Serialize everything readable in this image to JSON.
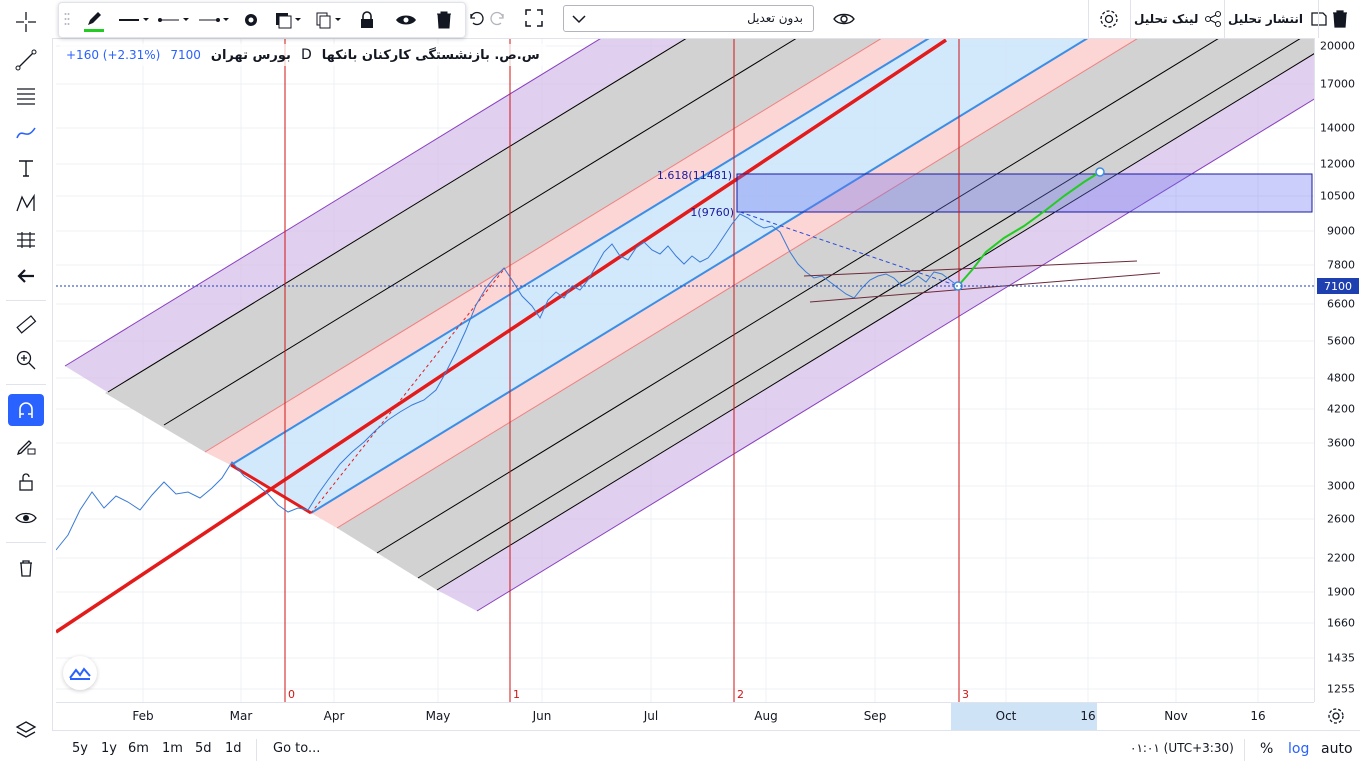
{
  "symbol": {
    "name": "س.ص. بازنشستگی کارکنان بانکها",
    "interval": "D",
    "exchange": "بورس تهران",
    "price": "7100",
    "change": "+160 (+2.31%)"
  },
  "top_toolbar": {
    "adjust_select": "بدون تعدیل",
    "link_analysis": "لینک تحلیل",
    "publish_analysis": "انتشار تحلیل"
  },
  "price_axis": {
    "labels": [
      "20000",
      "17000",
      "14000",
      "12000",
      "10500",
      "9000",
      "7800",
      "6600",
      "5600",
      "4800",
      "4200",
      "3600",
      "3000",
      "2600",
      "2200",
      "1900",
      "1660",
      "1435",
      "1255"
    ],
    "current_price": "7100"
  },
  "time_axis": {
    "labels": [
      "Feb",
      "Mar",
      "Apr",
      "May",
      "Jun",
      "Jul",
      "Aug",
      "Sep",
      "Oct",
      "16",
      "Nov",
      "16"
    ]
  },
  "drawings": {
    "cycle_labels": [
      "0",
      "1",
      "2",
      "3"
    ],
    "fib_levels": [
      "1.618(11481)",
      "1(9760)"
    ]
  },
  "bottom_bar": {
    "ranges": [
      "5y",
      "1y",
      "6m",
      "1m",
      "5d",
      "1d"
    ],
    "goto": "Go to...",
    "time": "۰۱:۰۱ (UTC+3:30)",
    "percent": "%",
    "log": "log",
    "auto": "auto"
  },
  "colors": {
    "accent": "#2962ff",
    "trend_red": "#e31b1b",
    "channel_purple": "#d6bfe8",
    "channel_blue": "#cde6fb",
    "channel_pink": "#fcd5d5",
    "channel_gray": "#d2d2d2",
    "projection_green": "#22cc22"
  }
}
